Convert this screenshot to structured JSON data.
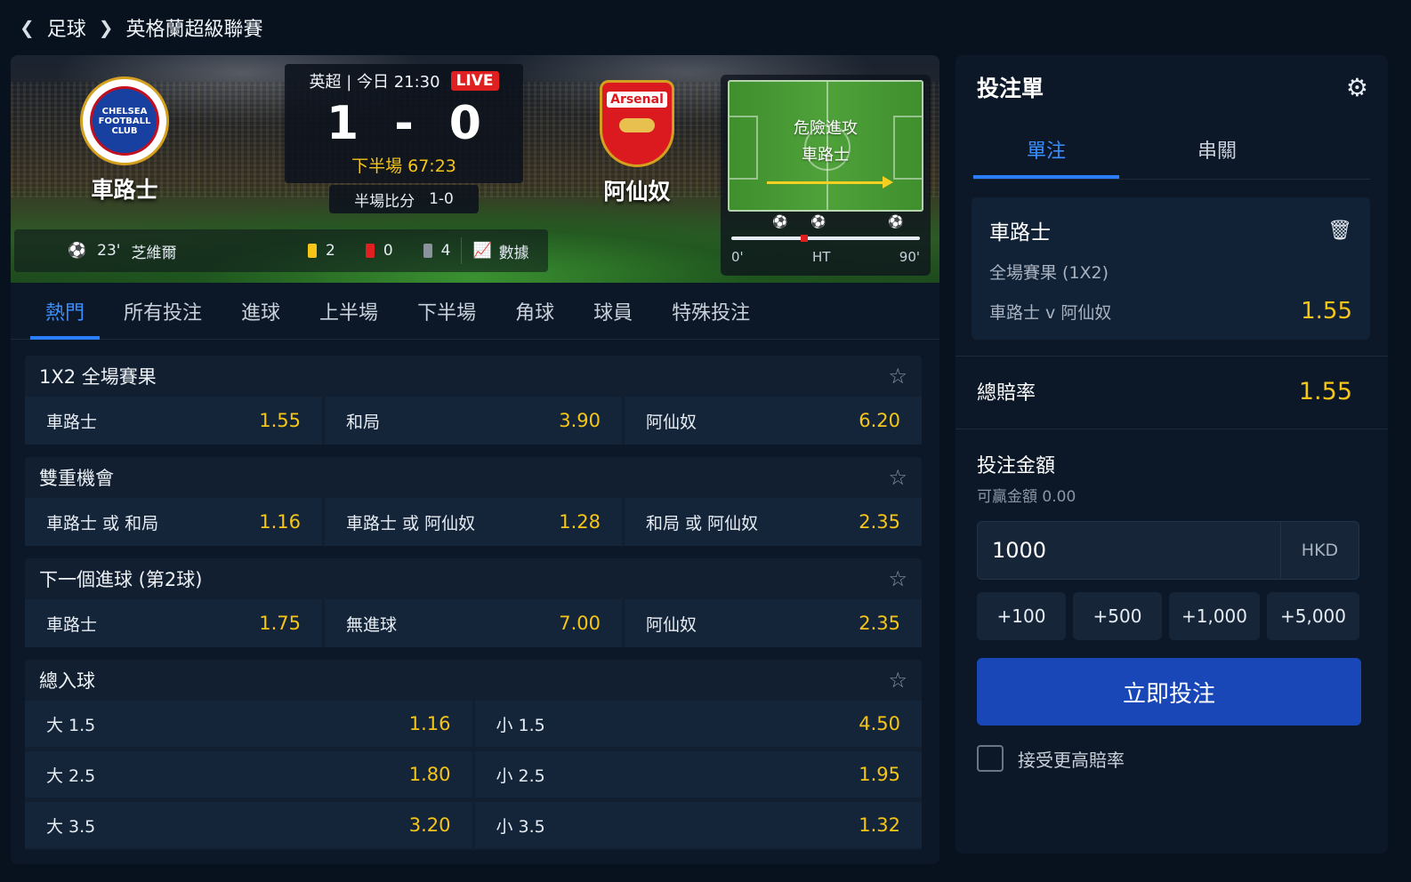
{
  "breadcrumb": {
    "sport": "足球",
    "league": "英格蘭超級聯賽"
  },
  "match": {
    "competition": "英超",
    "kickoff": "今日 21:30",
    "live_label": "LIVE",
    "home": "車路士",
    "away": "阿仙奴",
    "home_badge_text": "CHELSEA FOOTBALL CLUB",
    "away_badge_text": "Arsenal",
    "home_score": "1",
    "score_sep": "-",
    "away_score": "0",
    "clock": "下半場 67:23",
    "ht_label": "半場比分",
    "ht_score": "1-0",
    "goal_minute": "23'",
    "goal_scorer": "芝維爾",
    "yellow_cards": "2",
    "red_cards": "0",
    "corners": "4",
    "stats_label": "數據"
  },
  "pitch": {
    "status_line1": "危險進攻",
    "status_line2": "車路士",
    "tl_start": "0'",
    "tl_ht": "HT",
    "tl_end": "90'"
  },
  "tabs": [
    "熱門",
    "所有投注",
    "進球",
    "上半場",
    "下半場",
    "角球",
    "球員",
    "特殊投注"
  ],
  "markets": {
    "m1": {
      "title": "1X2 全場賽果",
      "sels": [
        {
          "label": "車路士",
          "odds": "1.55"
        },
        {
          "label": "和局",
          "odds": "3.90"
        },
        {
          "label": "阿仙奴",
          "odds": "6.20"
        }
      ]
    },
    "m2": {
      "title": "雙重機會",
      "sels": [
        {
          "label": "車路士 或 和局",
          "odds": "1.16"
        },
        {
          "label": "車路士 或 阿仙奴",
          "odds": "1.28"
        },
        {
          "label": "和局 或 阿仙奴",
          "odds": "2.35"
        }
      ]
    },
    "m3": {
      "title": "下一個進球 (第2球)",
      "sels": [
        {
          "label": "車路士",
          "odds": "1.75"
        },
        {
          "label": "無進球",
          "odds": "7.00"
        },
        {
          "label": "阿仙奴",
          "odds": "2.35"
        }
      ]
    },
    "m4": {
      "title": "總入球",
      "rows": [
        {
          "over": "大 1.5",
          "over_odds": "1.16",
          "under": "小 1.5",
          "under_odds": "4.50"
        },
        {
          "over": "大 2.5",
          "over_odds": "1.80",
          "under": "小 2.5",
          "under_odds": "1.95"
        },
        {
          "over": "大 3.5",
          "over_odds": "3.20",
          "under": "小 3.5",
          "under_odds": "1.32"
        }
      ]
    }
  },
  "slip": {
    "title": "投注單",
    "tab_single": "單注",
    "tab_multi": "串關",
    "selection": "車路士",
    "market": "全場賽果 (1X2)",
    "match": "車路士 v 阿仙奴",
    "odds": "1.55",
    "total_label": "總賠率",
    "total_odds": "1.55",
    "stake_label": "投注金額",
    "win_label": "可贏金額 0.00",
    "stake_value": "1000",
    "currency": "HKD",
    "quick": [
      "+100",
      "+500",
      "+1,000",
      "+5,000"
    ],
    "place_label": "立即投注",
    "accept_label": "接受更高賠率"
  },
  "colors": {
    "accent": "#2b7fff",
    "odds": "#f5c518",
    "live": "#e02020",
    "place_button": "#1947b8"
  },
  "icons": [
    "chevron-left-icon",
    "chevron-right-icon",
    "ball-icon",
    "chart-icon",
    "star-icon",
    "gear-icon",
    "trash-icon"
  ]
}
